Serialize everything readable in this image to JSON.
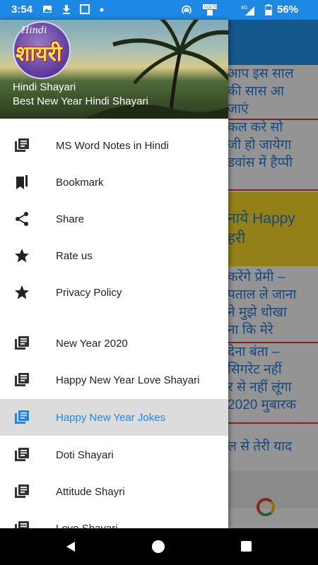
{
  "status_bar": {
    "time": "3:54",
    "battery": "56%",
    "icons": [
      "image-icon",
      "download-icon",
      "checkbox-icon",
      "dot-icon",
      "hotspot-icon",
      "volte-icon",
      "signal-4g-icon",
      "battery-icon"
    ],
    "color": "#1e88e5"
  },
  "drawer": {
    "logo_script": "Hindi",
    "logo_text": "शायरी",
    "app_name": "Hindi Shayari",
    "app_subtitle": "Best New Year Hindi Shayari",
    "items": [
      {
        "label": "MS Word Notes in Hindi",
        "icon": "notes-icon"
      },
      {
        "label": "Bookmark",
        "icon": "bookmark-icon"
      },
      {
        "label": "Share",
        "icon": "share-icon"
      },
      {
        "label": "Rate us",
        "icon": "star-icon"
      },
      {
        "label": "Privacy Policy",
        "icon": "star-icon"
      },
      {
        "label": "New Year 2020",
        "icon": "notes-icon"
      },
      {
        "label": "Happy New Year Love Shayari",
        "icon": "notes-icon"
      },
      {
        "label": "Happy New Year Jokes",
        "icon": "notes-icon",
        "active": true
      },
      {
        "label": "Doti Shayari",
        "icon": "notes-icon"
      },
      {
        "label": "Attitude Shayri",
        "icon": "notes-icon"
      },
      {
        "label": "Love Shayari",
        "icon": "notes-icon"
      }
    ],
    "accent": "#1e88e5"
  },
  "background_list": {
    "items": [
      {
        "lines": [
          "आप इस साल",
          "की सास आ",
          "जाएं"
        ]
      },
      {
        "lines": [
          "कल करे सो",
          "जी हो जायेगा",
          "डवांस में हैप्पी"
        ]
      },
      {
        "lines": [
          "नाये Happy",
          "हरी"
        ]
      },
      {
        "lines": [
          "करेंगे प्रेमी –",
          "पताल ले जाना",
          "ने मुझे धोखा",
          "ना कि मेरे"
        ]
      },
      {
        "lines": [
          "देना बंता –",
          "सिगरेट नहीं",
          "र से नहीं लूंगा",
          "2020 मुबारक"
        ]
      },
      {
        "lines": [
          "ल से तेरी याद"
        ]
      }
    ]
  }
}
